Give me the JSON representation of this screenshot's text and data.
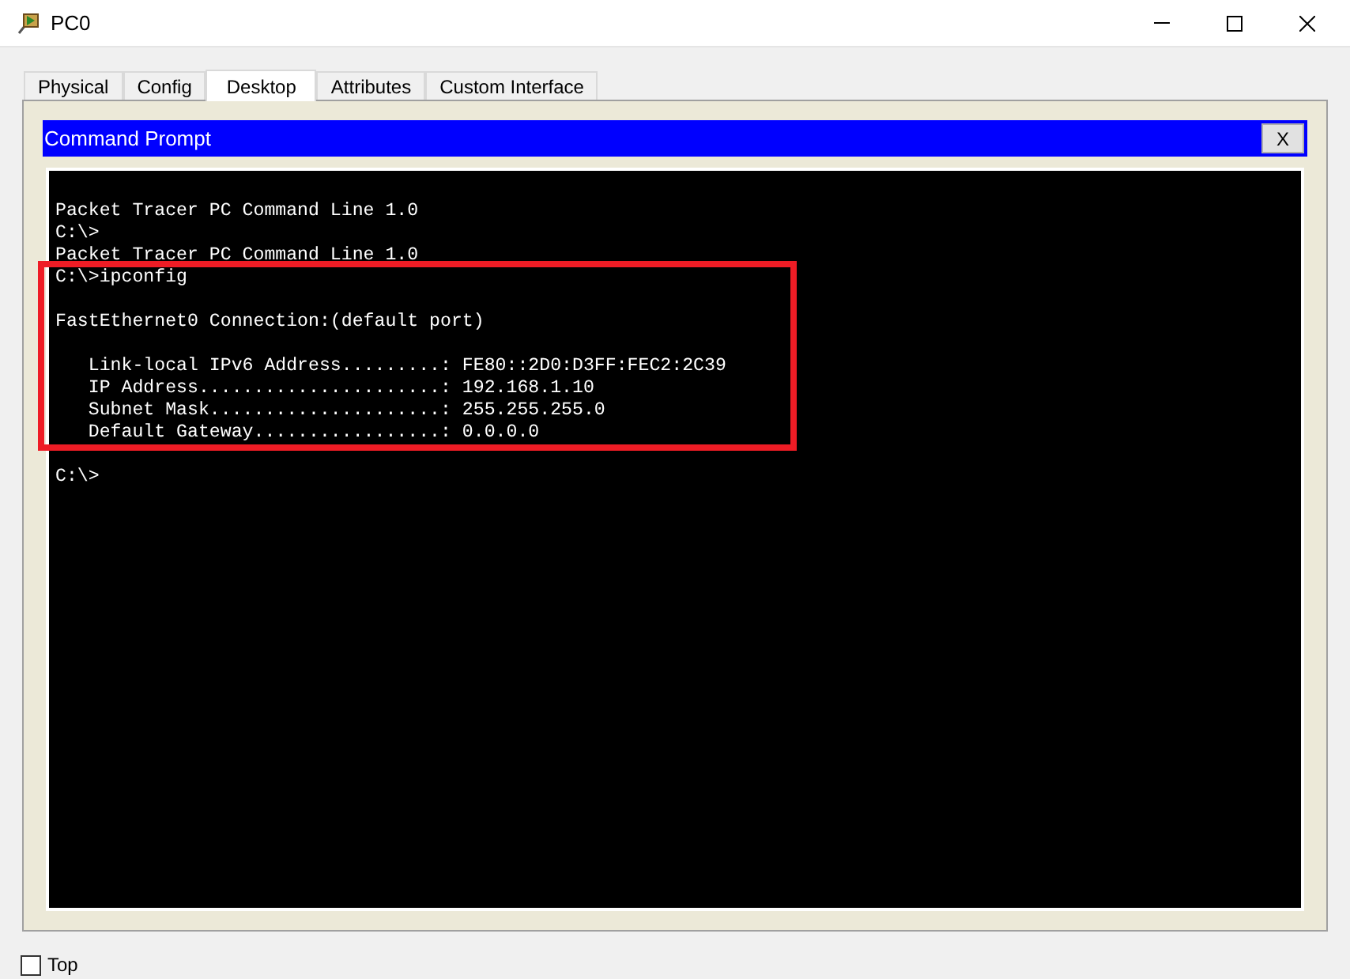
{
  "window": {
    "title": "PC0"
  },
  "tabs": [
    {
      "label": "Physical",
      "selected": false
    },
    {
      "label": "Config",
      "selected": false
    },
    {
      "label": "Desktop",
      "selected": true
    },
    {
      "label": "Attributes",
      "selected": false
    },
    {
      "label": "Custom Interface",
      "selected": false
    }
  ],
  "command_prompt": {
    "title": "Command Prompt",
    "close_label": "X",
    "segments": [
      {
        "kind": "plain",
        "lines": [
          {
            "kind": "text",
            "text": "Packet Tracer PC Command Line 1.0"
          },
          {
            "kind": "text",
            "text": "C:\\>"
          },
          {
            "kind": "text",
            "text": "Packet Tracer PC Command Line 1.0"
          }
        ]
      },
      {
        "kind": "highlighted",
        "lines": [
          {
            "kind": "text",
            "text": "C:\\>ipconfig"
          },
          {
            "kind": "blank"
          },
          {
            "kind": "text",
            "text": "FastEthernet0 Connection:(default port)"
          },
          {
            "kind": "blank"
          },
          {
            "kind": "text",
            "text": "   Link-local IPv6 Address.........: FE80::2D0:D3FF:FEC2:2C39"
          },
          {
            "kind": "text",
            "text": "   IP Address......................: 192.168.1.10"
          },
          {
            "kind": "text",
            "text": "   Subnet Mask.....................: 255.255.255.0"
          },
          {
            "kind": "text",
            "text": "   Default Gateway.................: 0.0.0.0"
          }
        ]
      },
      {
        "kind": "plain",
        "lines": [
          {
            "kind": "blank"
          },
          {
            "kind": "text",
            "text": "C:\\>"
          }
        ]
      }
    ]
  },
  "top_checkbox": {
    "label": "Top",
    "checked": false
  }
}
